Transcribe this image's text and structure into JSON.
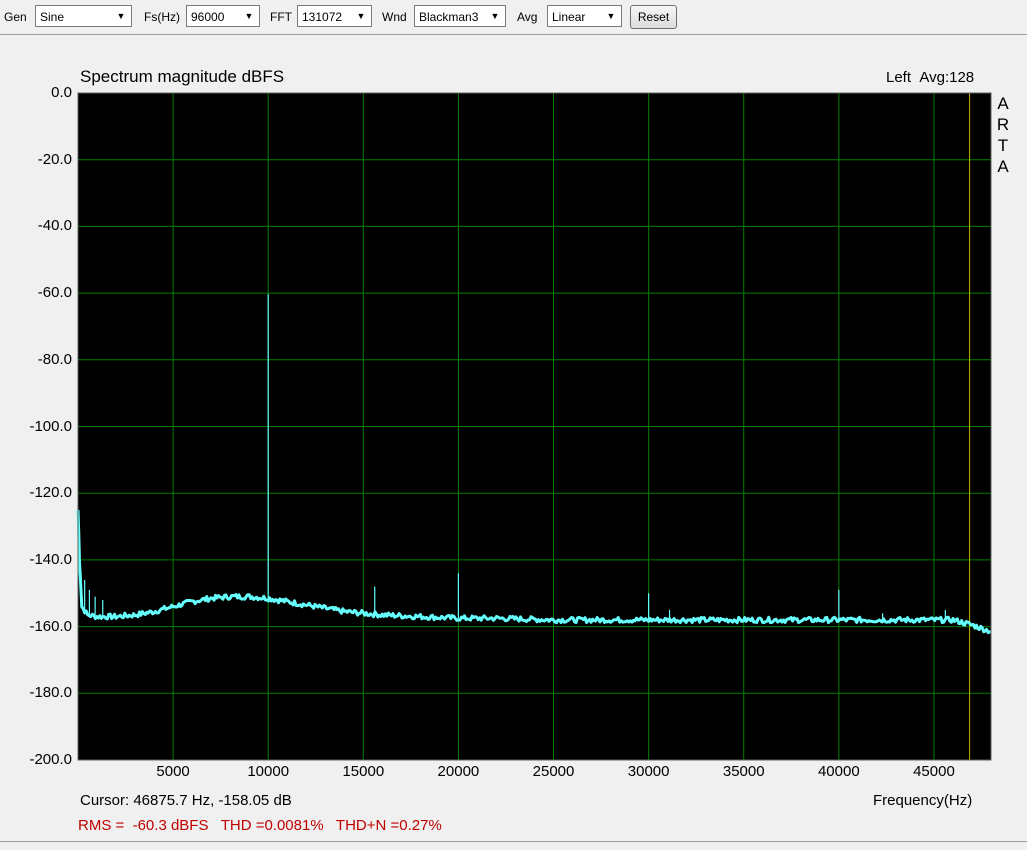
{
  "toolbar": {
    "gen_label": "Gen",
    "gen_value": "Sine",
    "fs_label": "Fs(Hz)",
    "fs_value": "96000",
    "fft_label": "FFT",
    "fft_value": "131072",
    "wnd_label": "Wnd",
    "wnd_value": "Blackman3",
    "avg_label": "Avg",
    "avg_value": "Linear",
    "reset_label": "Reset"
  },
  "colors": {
    "plot_bg": "#000000",
    "grid": "#008000",
    "trace": "#66ffff",
    "cursor_line": "#c8b400",
    "measurement": "#c00000"
  },
  "chart_data": {
    "type": "line",
    "title": "Spectrum magnitude dBFS",
    "channel": "Left",
    "avg": "Avg:128",
    "xlabel": "Frequency(Hz)",
    "ylabel": "",
    "xlim": [
      0,
      48000
    ],
    "ylim": [
      -200,
      0
    ],
    "grid": true,
    "y_ticks": [
      "0.0",
      "-20.0",
      "-40.0",
      "-60.0",
      "-80.0",
      "-100.0",
      "-120.0",
      "-140.0",
      "-160.0",
      "-180.0",
      "-200.0"
    ],
    "x_ticks": [
      "5000",
      "10000",
      "15000",
      "20000",
      "25000",
      "30000",
      "35000",
      "40000",
      "45000"
    ],
    "x_tick_values": [
      5000,
      10000,
      15000,
      20000,
      25000,
      30000,
      35000,
      40000,
      45000
    ],
    "y_tick_values": [
      0,
      -20,
      -40,
      -60,
      -80,
      -100,
      -120,
      -140,
      -160,
      -180,
      -200
    ],
    "noise_floor": {
      "x": [
        0,
        80,
        200,
        500,
        1000,
        2000,
        3000,
        4000,
        5000,
        6000,
        7000,
        8000,
        9000,
        10000,
        11000,
        12000,
        13000,
        14000,
        15000,
        16000,
        18000,
        20000,
        22000,
        25000,
        28000,
        30000,
        33000,
        36000,
        40000,
        44000,
        46000,
        47000,
        48000
      ],
      "y": [
        -125,
        -140,
        -154,
        -156.5,
        -157,
        -157,
        -156.5,
        -155.5,
        -154,
        -152.5,
        -151.5,
        -151,
        -151,
        -151.5,
        -152.5,
        -153.5,
        -154.5,
        -155.5,
        -156,
        -156.5,
        -157,
        -157.5,
        -157.5,
        -158,
        -158,
        -158,
        -158,
        -158,
        -158,
        -158,
        -158,
        -159.5,
        -161.5
      ]
    },
    "peaks": [
      {
        "x": 10000,
        "y": -60.3
      },
      {
        "x": 15600,
        "y": -148
      },
      {
        "x": 20000,
        "y": -144
      },
      {
        "x": 30000,
        "y": -150
      },
      {
        "x": 31100,
        "y": -155
      },
      {
        "x": 40000,
        "y": -149
      },
      {
        "x": 42300,
        "y": -156
      },
      {
        "x": 45600,
        "y": -155
      },
      {
        "x": 350,
        "y": -146
      },
      {
        "x": 600,
        "y": -149
      },
      {
        "x": 900,
        "y": -151
      },
      {
        "x": 1300,
        "y": -152
      }
    ],
    "cursor_x": 46875.7
  },
  "readouts": {
    "cursor": "Cursor: 46875.7 Hz, -158.05 dB",
    "measurements": "RMS =  -60.3 dBFS   THD =0.0081%   THD+N =0.27%"
  },
  "watermark": [
    "A",
    "R",
    "T",
    "A"
  ]
}
